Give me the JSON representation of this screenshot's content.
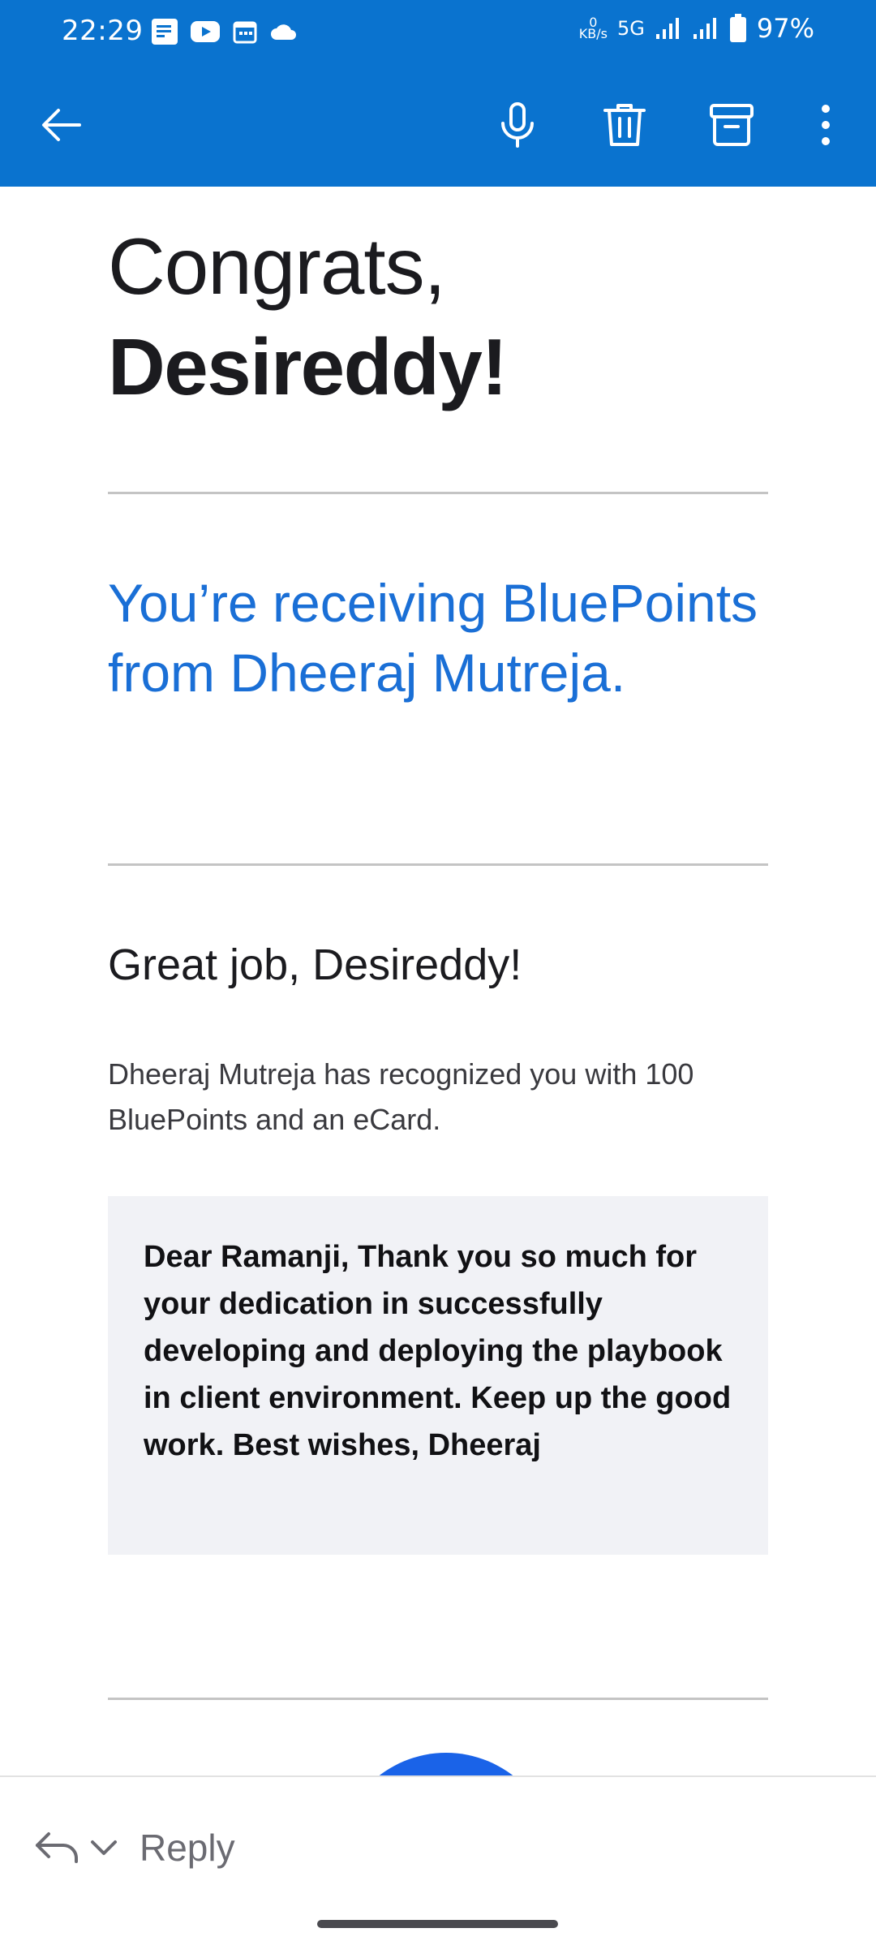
{
  "status_bar": {
    "time": "22:29",
    "net_speed_value": "0",
    "net_speed_unit": "KB/s",
    "network": "5G",
    "battery": "97%",
    "icons": [
      "notes-icon",
      "youtube-icon",
      "calendar-icon",
      "cloud-icon",
      "signal-icon",
      "signal-icon",
      "battery-icon"
    ]
  },
  "app_bar": {
    "actions": [
      "back-arrow-icon",
      "microphone-icon",
      "trash-icon",
      "archive-icon",
      "more-vertical-icon"
    ],
    "color": "#0a73cf"
  },
  "email": {
    "greeting_line1": "Congrats,",
    "greeting_line2": "Desireddy!",
    "headline": "You’re receiving BluePoints from Dheeraj Mutreja.",
    "great_job": "Great job, Desireddy!",
    "recognition": "Dheeraj Mutreja has recognized you with 100 BluePoints and an eCard.",
    "message": "Dear Ramanji, Thank you so much for your dedication in successfully developing and deploying the playbook in client environment. Keep up the good work. Best wishes, Dheeraj",
    "accent_color": "#1a6fd6"
  },
  "reply_bar": {
    "label": "Reply"
  }
}
